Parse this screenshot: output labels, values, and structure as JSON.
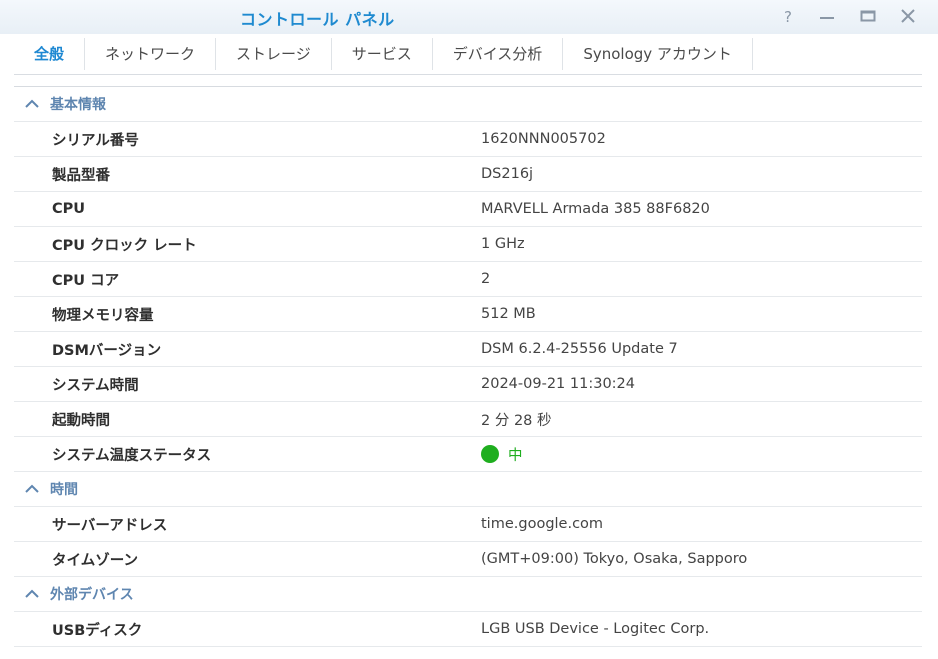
{
  "window": {
    "title": "コントロール パネル",
    "controls": [
      {
        "name": "help-button",
        "icon": "help-icon"
      },
      {
        "name": "minimize-button",
        "icon": "minimize-icon"
      },
      {
        "name": "maximize-button",
        "icon": "maximize-icon"
      },
      {
        "name": "close-button",
        "icon": "close-icon"
      }
    ]
  },
  "tabs": [
    {
      "label": "全般",
      "active": true
    },
    {
      "label": "ネットワーク",
      "active": false
    },
    {
      "label": "ストレージ",
      "active": false
    },
    {
      "label": "サービス",
      "active": false
    },
    {
      "label": "デバイス分析",
      "active": false
    },
    {
      "label": "Synology アカウント",
      "active": false
    }
  ],
  "sections": {
    "basic": {
      "title": "基本情報",
      "rows": [
        {
          "label": "シリアル番号",
          "value": "1620NNN005702"
        },
        {
          "label": "製品型番",
          "value": "DS216j"
        },
        {
          "label": "CPU",
          "value": "MARVELL Armada 385 88F6820"
        },
        {
          "label": "CPU クロック レート",
          "value": "1 GHz"
        },
        {
          "label": "CPU コア",
          "value": "2"
        },
        {
          "label": "物理メモリ容量",
          "value": "512 MB"
        },
        {
          "label": "DSMバージョン",
          "value": "DSM 6.2.4-25556 Update 7"
        },
        {
          "label": "システム時間",
          "value": "2024-09-21 11:30:24"
        },
        {
          "label": "起動時間",
          "value": "2 分 28 秒"
        },
        {
          "label": "システム温度ステータス",
          "value": "中",
          "status_color": "#1fae1f"
        }
      ]
    },
    "time": {
      "title": "時間",
      "rows": [
        {
          "label": "サーバーアドレス",
          "value": "time.google.com"
        },
        {
          "label": "タイムゾーン",
          "value": "(GMT+09:00) Tokyo, Osaka, Sapporo"
        }
      ]
    },
    "external": {
      "title": "外部デバイス",
      "rows": [
        {
          "label": "USBディスク",
          "value": "LGB USB Device - Logitec Corp."
        }
      ]
    }
  },
  "colors": {
    "accent": "#1e88d2",
    "section": "#5f86b0",
    "status_ok": "#1fae1f"
  }
}
